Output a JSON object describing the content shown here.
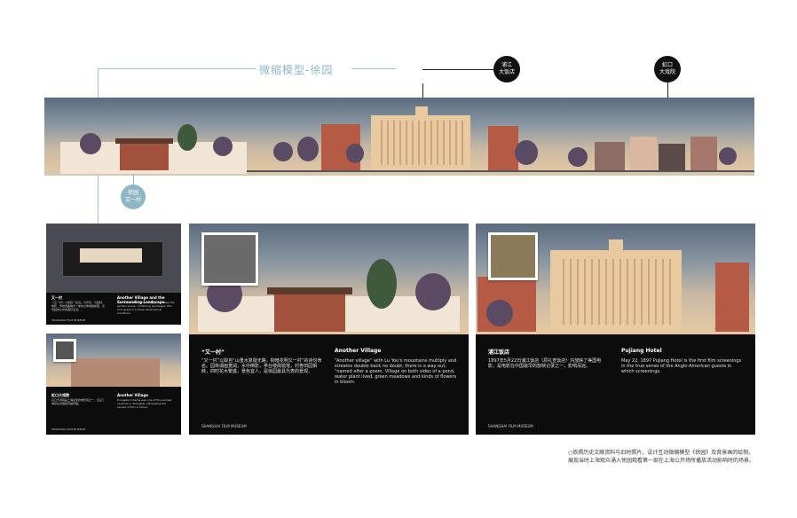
{
  "header": {
    "title": "微缩模型-徐园"
  },
  "callouts": {
    "pujiang": [
      "浦江",
      "大饭店"
    ],
    "hongkou": [
      "虹口",
      "大戏院"
    ],
    "xuyuan": [
      "徐园",
      "又一村"
    ]
  },
  "panels": {
    "small_top": {
      "left_head": "又一村",
      "left_text": "《又一村》以徐园「仙境」为背景，与园林、电影、传统戏曲融为一体的立体微缩模型，表现园林之中的美好生活。",
      "right_head": "Another Village and the Surrounding Landscape",
      "right_text": "The model of Another Village recreates the garden scene, combining landscape, film and opera in a three-dimensional miniature.",
      "footer": "SHANGHAI FILM MUSEUM"
    },
    "small_bottom": {
      "left_head": "虹口大戏院",
      "left_text": "虹口大戏院是上海最早的电影院之一，见证了电影在中国的传播历程。",
      "right_head": "Another Village",
      "right_text": "Hongkew Cinema was one of the earliest cinemas in Shanghai, witnessing the spread of film in China.",
      "footer": "SHANGHAI FILM MUSEUM"
    },
    "mid": {
      "left_head": "“又一村”",
      "left_text": "“又一村”以取自“山重水复疑无路，柳暗花明又一村”的诗句命名。园林湖面宽阔，水中倒影，亭台楼阁错落，村舍田园相映，四时花木繁盛，景色宜人，是徐园最具代表的景观。",
      "right_head": "Another Village",
      "right_text": "“Another village” with Lu You's mountains multiply and streams double back no doubt, there is a way out, “named after a poem. Village on both sides of a pond, water plant lived, green meadows and kinds of flowers in bloom.",
      "footer": "SHANGHAI FILM MUSEUM"
    },
    "right": {
      "left_head": "浦江饭店",
      "left_text": "1897年5月22日浦江饭店（原礼查饭店）内放映了美国电影，是电影在中国最早的放映记录之一，影响深远。",
      "right_head": "Pujiang Hotel",
      "right_text": "May 22, 1897 Pujiang Hotel is the first film screenings in the true sense of the Anglo-American guests in which screenings.",
      "footer": "SHANGHAI FILM MUSEUM"
    }
  },
  "caption": "○依照历史文献资料与旧时照片，设计互动微缩模型《徐园》及背景画的绘制。展现当时上海观众涌入徐园观看第一部在上海公开场所播放活动影响时的场景。",
  "colors": {
    "accent": "#8fb6c6",
    "panel_bg": "#0c0c0c",
    "building": "#e8c9a0",
    "brick": "#b45a45"
  }
}
